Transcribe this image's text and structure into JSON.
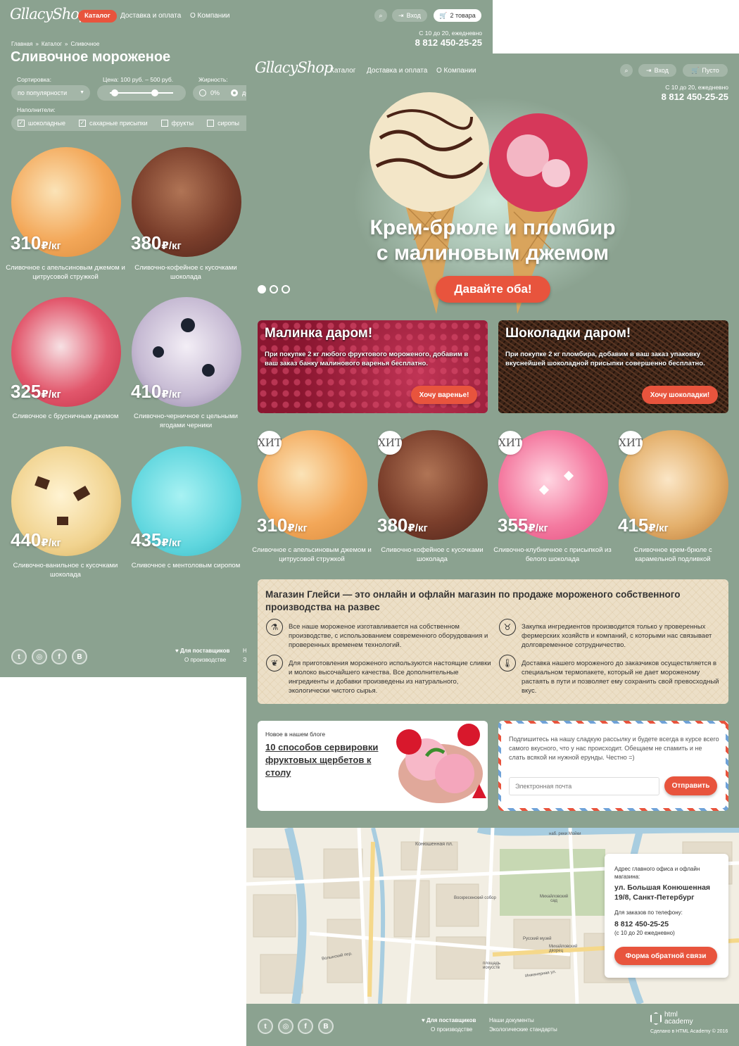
{
  "brand": "GllacyShop",
  "catalog_page": {
    "nav": {
      "catalog": "Каталог",
      "delivery": "Доставка и оплата",
      "about": "О Компании"
    },
    "login": "Вход",
    "cart": "2 товара",
    "hours": "С 10 до 20, ежедневно",
    "phone": "8 812 450-25-25",
    "breadcrumbs": [
      "Главная",
      "»",
      "Каталог",
      "»",
      "Сливочное"
    ],
    "title": "Сливочное мороженое",
    "sort_label": "Сортировка:",
    "sort_value": "по популярности",
    "price_label": "Цена: 100 руб. – 500 руб.",
    "fat_label": "Жирность:",
    "fat_options": [
      "0%",
      "до"
    ],
    "fillers_label": "Наполнители:",
    "fillers": [
      {
        "label": "шоколадные",
        "checked": true
      },
      {
        "label": "сахарные присыпки",
        "checked": true
      },
      {
        "label": "фрукты",
        "checked": false
      },
      {
        "label": "сиропы",
        "checked": false
      }
    ],
    "products": [
      {
        "price": "310",
        "unit": "₽/кг",
        "name": "Сливочное с апельсиновым джемом и цитрусовой стружкой"
      },
      {
        "price": "380",
        "unit": "₽/кг",
        "name": "Сливочно-кофейное с кусочками шоколада"
      },
      {
        "price": "325",
        "unit": "₽/кг",
        "name": "Сливочное с брусничным джемом"
      },
      {
        "price": "410",
        "unit": "₽/кг",
        "name": "Сливочно-черничное с цельными ягодами черники"
      },
      {
        "price": "440",
        "unit": "₽/кг",
        "name": "Сливочно-ванильное с кусочками шоколада"
      },
      {
        "price": "435",
        "unit": "₽/кг",
        "name": "Сливочное с ментоловым сиропом"
      }
    ],
    "footer": {
      "suppliers": "Для поставщиков",
      "production": "О производстве",
      "col2a": "Н",
      "col2b": "Э"
    }
  },
  "home_page": {
    "nav": {
      "catalog": "Каталог",
      "delivery": "Доставка и оплата",
      "about": "О Компании"
    },
    "login": "Вход",
    "cart": "Пусто",
    "hours": "С 10 до 20, ежедневно",
    "phone": "8 812 450-25-25",
    "hero_line1": "Крем-брюле и пломбир",
    "hero_line2": "с малиновым джемом",
    "hero_button": "Давайте оба!",
    "promos": [
      {
        "title": "Малинка даром!",
        "text": "При покупке 2 кг любого фруктового мороженого, добавим в ваш заказ банку малинового варенья бесплатно.",
        "button": "Хочу варенье!"
      },
      {
        "title": "Шоколадки даром!",
        "text": "При покупке 2 кг пломбира, добавим в ваш заказ упаковку вкуснейшей шоколадной присыпки совершенно бесплатно.",
        "button": "Хочу шоколадки!"
      }
    ],
    "hit_label": "ХИТ",
    "hits": [
      {
        "price": "310",
        "unit": "₽/кг",
        "name": "Сливочное с апельсиновым джемом и цитрусовой стружкой"
      },
      {
        "price": "380",
        "unit": "₽/кг",
        "name": "Сливочно-кофейное с кусочками шоколада"
      },
      {
        "price": "355",
        "unit": "₽/кг",
        "name": "Сливочно-клубничное с присыпкой из белого шоколада"
      },
      {
        "price": "415",
        "unit": "₽/кг",
        "name": "Сливочное крем-брюле с карамельной подливкой"
      }
    ],
    "about_title": "Магазин Глейси  — это онлайн и офлайн магазин по продаже мороженого собственного производства на развес",
    "features": [
      "Все наше мороженое изготавливается на собственном производстве, с использованием современного оборудования и проверенных временем технологий.",
      "Закупка ингредиентов  производится только у проверенных фермерских хозяйств и компаний, с которыми нас связывает долговременное сотрудничество.",
      "Для приготовления мороженого используются настоящие сливки и молоко высочайшего качества. Все дополнительные ингредиенты и добавки произведены из натурального, экологически чистого сырья.",
      "Доставка нашего мороженого до заказчиков осуществляется в специальном термопакете, который не дает мороженому растаять в пути и позволяет ему сохранить свой превосходный вкус."
    ],
    "blog_label": "Новое в нашем блоге",
    "blog_title": "10  способов сервировки фруктовых щербетов к столу",
    "subscribe_text": "Подпишитесь на нашу сладкую рассылку и будете всегда в курсе всего самого вкусного, что у нас происходит. Обещаем не спамить и не слать всякой ни нужной ерунды. Честно =)",
    "email_placeholder": "Электронная почта",
    "subscribe_button": "Отправить",
    "map_labels": [
      "Конюшенная пл.",
      "Михайловский сад",
      "Воскресенский собор",
      "Русский музей",
      "Михайловский дворец",
      "Инженерная ул.",
      "Волынский пер.",
      "наб. реки Мойки",
      "площадь искусств"
    ],
    "contact": {
      "addr_label": "Адрес главного офиса и офлайн магазина:",
      "address": "ул. Большая Конюшенная 19/8, Санкт-Петербург",
      "phone_label": "Для заказов по телефону:",
      "phone": "8 812 450-25-25",
      "hours": "(с 10 до 20 ежедневно)",
      "button": "Форма обратной связи"
    },
    "footer": {
      "suppliers": "Для поставщиков",
      "production": "О производстве",
      "documents": "Наши документы",
      "eco": "Экологические стандарты",
      "academy": "html academy",
      "credit": "Сделано в HTML Academy © 2016"
    }
  },
  "colors": {
    "bg": "#8ba290",
    "accent": "#e8543d",
    "beige": "#ecdfc7"
  }
}
